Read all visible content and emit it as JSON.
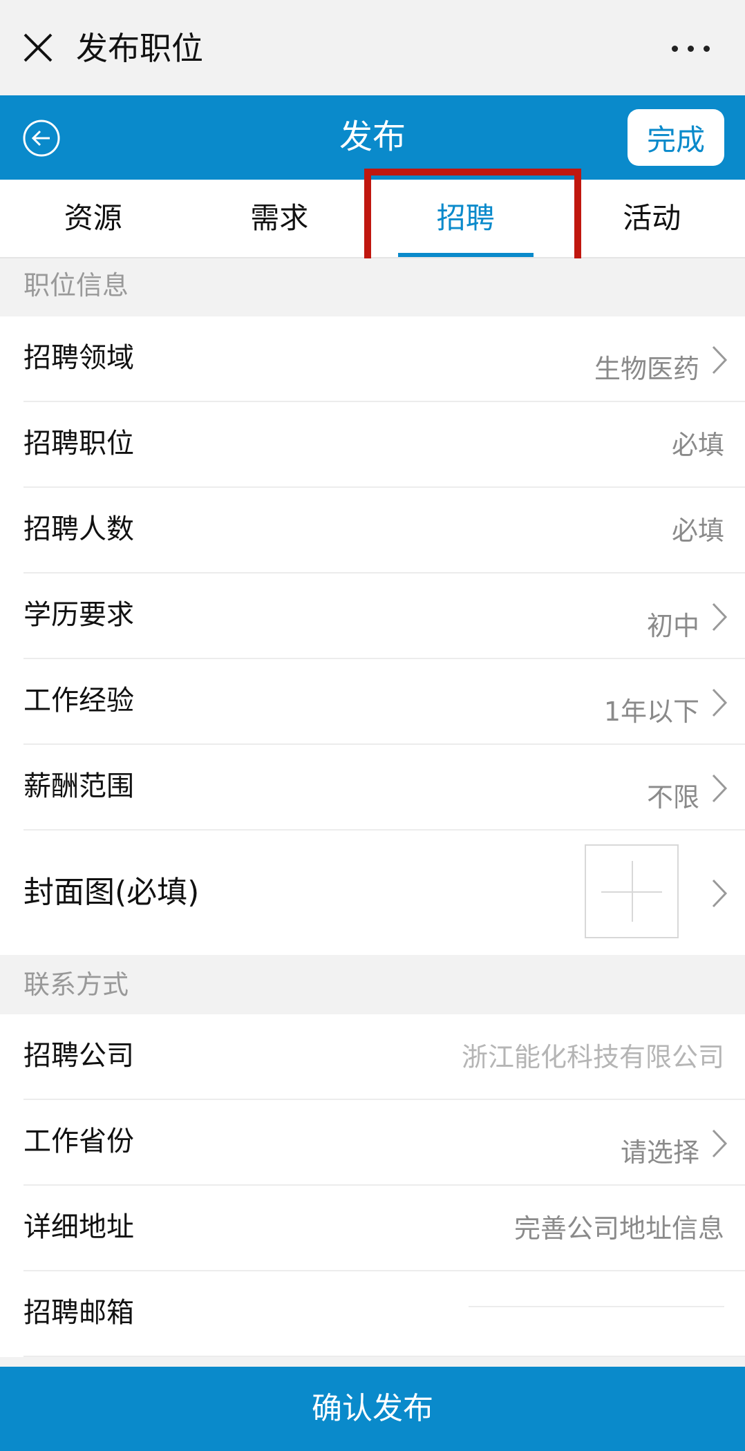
{
  "window": {
    "title": "发布职位"
  },
  "header": {
    "title": "发布",
    "done_label": "完成"
  },
  "tabs": [
    {
      "label": "资源"
    },
    {
      "label": "需求"
    },
    {
      "label": "招聘"
    },
    {
      "label": "活动"
    }
  ],
  "sections": {
    "job_info": "职位信息",
    "contact": "联系方式"
  },
  "job_fields": {
    "field": {
      "label": "招聘领域",
      "value": "生物医药"
    },
    "position": {
      "label": "招聘职位",
      "placeholder": "必填"
    },
    "headcount": {
      "label": "招聘人数",
      "placeholder": "必填"
    },
    "education": {
      "label": "学历要求",
      "value": "初中"
    },
    "experience": {
      "label": "工作经验",
      "value": "1年以下"
    },
    "salary": {
      "label": "薪酬范围",
      "value": "不限"
    },
    "cover": {
      "label": "封面图(必填)"
    }
  },
  "contact_fields": {
    "company": {
      "label": "招聘公司",
      "value": "浙江能化科技有限公司"
    },
    "province": {
      "label": "工作省份",
      "value": "请选择"
    },
    "address": {
      "label": "详细地址",
      "value": "完善公司地址信息"
    },
    "email": {
      "label": "招聘邮箱"
    }
  },
  "footer": {
    "confirm_label": "确认发布"
  },
  "colors": {
    "brand_blue": "#0a8acb",
    "highlight_red": "#c0170f"
  }
}
